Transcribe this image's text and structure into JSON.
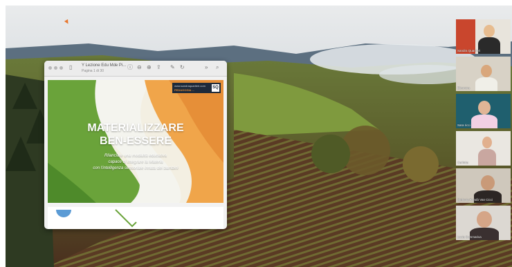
{
  "presentation": {
    "window_title": "Y Lezione Edu Mde Pi...",
    "page_indicator": "Pagina 1 di 30",
    "slide": {
      "brand_url": "www.sandraquartieri.com",
      "brand_name": "PEDAGOGIA ...",
      "brand_logo": "SQ",
      "title_line1": "MATERIALIZZARE",
      "title_line2": "BEN-ESSERE",
      "subtitle_line1": "Rilanciare una modalità educativa",
      "subtitle_line2": "capace di integrare la Materia",
      "subtitle_line3": "con l'intelligenza sensoriale innata dei bambini"
    },
    "toolbar_icons": [
      "sidebar-icon",
      "info-icon",
      "zoom-out-icon",
      "zoom-in-icon",
      "share-icon",
      "markup-icon",
      "rotate-icon",
      "more-icon",
      "search-icon"
    ]
  },
  "participants": [
    {
      "name": "Sandra Quartieri"
    },
    {
      "name": "Eleonora"
    },
    {
      "name": "Sara ricci"
    },
    {
      "name": "Carlotta"
    },
    {
      "name": "Stefania Randò Van Cicci"
    },
    {
      "name": "Lucia Sommariva"
    }
  ],
  "colors": {
    "accent_orange": "#e38a33",
    "slide_green": "#6aa33a",
    "brand_navy": "#1e2a3a"
  }
}
